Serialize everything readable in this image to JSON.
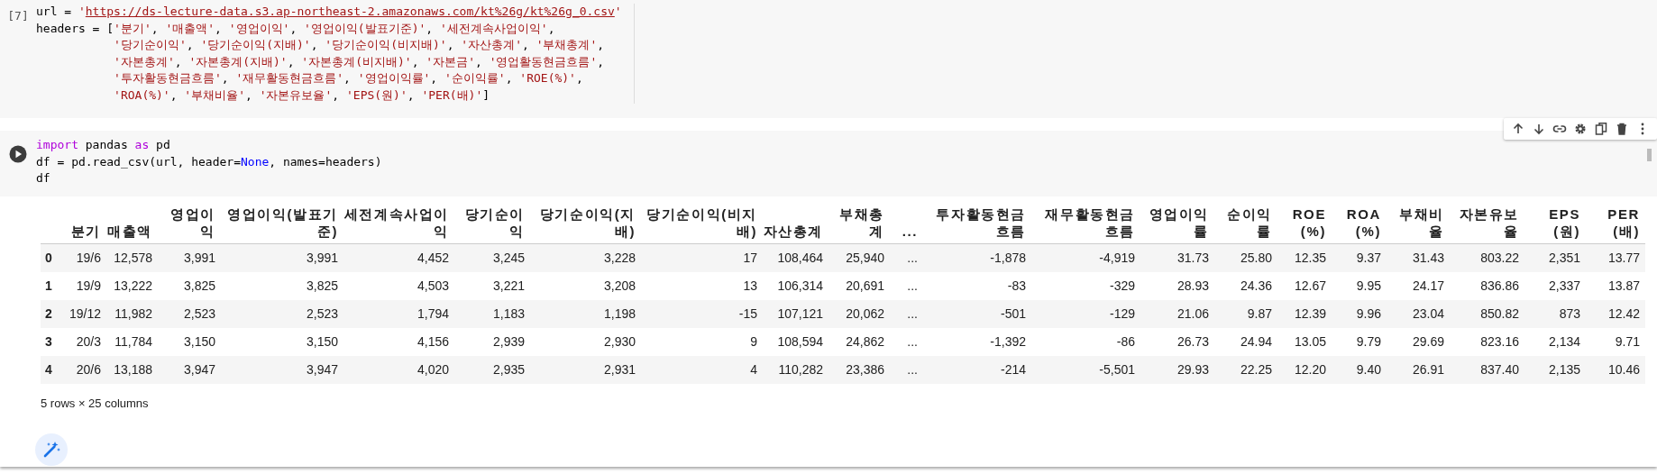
{
  "cells": [
    {
      "focused": false,
      "prompt": "[7]",
      "lines": [
        [
          {
            "kind": "plain",
            "text": "url = "
          },
          {
            "kind": "str",
            "text": "'"
          },
          {
            "kind": "link",
            "text": "https://ds-lecture-data.s3.ap-northeast-2.amazonaws.com/kt%26g/kt%26g_0.csv"
          },
          {
            "kind": "str",
            "text": "'"
          }
        ],
        [
          {
            "kind": "plain",
            "text": "headers = ["
          },
          {
            "kind": "str",
            "text": "'분기'"
          },
          {
            "kind": "plain",
            "text": ", "
          },
          {
            "kind": "str",
            "text": "'매출액'"
          },
          {
            "kind": "plain",
            "text": ", "
          },
          {
            "kind": "str",
            "text": "'영업이익'"
          },
          {
            "kind": "plain",
            "text": ", "
          },
          {
            "kind": "str",
            "text": "'영업이익(발표기준)'"
          },
          {
            "kind": "plain",
            "text": ", "
          },
          {
            "kind": "str",
            "text": "'세전계속사업이익'"
          },
          {
            "kind": "plain",
            "text": ","
          }
        ],
        [
          {
            "kind": "indent"
          },
          {
            "kind": "str",
            "text": "'당기순이익'"
          },
          {
            "kind": "plain",
            "text": ", "
          },
          {
            "kind": "str",
            "text": "'당기순이익(지배)'"
          },
          {
            "kind": "plain",
            "text": ", "
          },
          {
            "kind": "str",
            "text": "'당기순이익(비지배)'"
          },
          {
            "kind": "plain",
            "text": ", "
          },
          {
            "kind": "str",
            "text": "'자산총계'"
          },
          {
            "kind": "plain",
            "text": ", "
          },
          {
            "kind": "str",
            "text": "'부채총계'"
          },
          {
            "kind": "plain",
            "text": ","
          }
        ],
        [
          {
            "kind": "indent"
          },
          {
            "kind": "str",
            "text": "'자본총계'"
          },
          {
            "kind": "plain",
            "text": ", "
          },
          {
            "kind": "str",
            "text": "'자본총계(지배)'"
          },
          {
            "kind": "plain",
            "text": ", "
          },
          {
            "kind": "str",
            "text": "'자본총계(비지배)'"
          },
          {
            "kind": "plain",
            "text": ", "
          },
          {
            "kind": "str",
            "text": "'자본금'"
          },
          {
            "kind": "plain",
            "text": ", "
          },
          {
            "kind": "str",
            "text": "'영업활동현금흐름'"
          },
          {
            "kind": "plain",
            "text": ","
          }
        ],
        [
          {
            "kind": "indent"
          },
          {
            "kind": "str",
            "text": "'투자활동현금흐름'"
          },
          {
            "kind": "plain",
            "text": ", "
          },
          {
            "kind": "str",
            "text": "'재무활동현금흐름'"
          },
          {
            "kind": "plain",
            "text": ", "
          },
          {
            "kind": "str",
            "text": "'영업이익률'"
          },
          {
            "kind": "plain",
            "text": ", "
          },
          {
            "kind": "str",
            "text": "'순이익률'"
          },
          {
            "kind": "plain",
            "text": ", "
          },
          {
            "kind": "str",
            "text": "'ROE(%)'"
          },
          {
            "kind": "plain",
            "text": ","
          }
        ],
        [
          {
            "kind": "indent"
          },
          {
            "kind": "str",
            "text": "'ROA(%)'"
          },
          {
            "kind": "plain",
            "text": ", "
          },
          {
            "kind": "str",
            "text": "'부채비율'"
          },
          {
            "kind": "plain",
            "text": ", "
          },
          {
            "kind": "str",
            "text": "'자본유보율'"
          },
          {
            "kind": "plain",
            "text": ", "
          },
          {
            "kind": "str",
            "text": "'EPS(원)'"
          },
          {
            "kind": "plain",
            "text": ", "
          },
          {
            "kind": "str",
            "text": "'PER(배)'"
          },
          {
            "kind": "plain",
            "text": "]"
          }
        ]
      ]
    },
    {
      "focused": true,
      "lines": [
        [
          {
            "kind": "keyword",
            "text": "import"
          },
          {
            "kind": "plain",
            "text": " pandas "
          },
          {
            "kind": "keyword",
            "text": "as"
          },
          {
            "kind": "plain",
            "text": " pd"
          }
        ],
        [
          {
            "kind": "plain",
            "text": "df = pd.read_csv(url, header="
          },
          {
            "kind": "const",
            "text": "None"
          },
          {
            "kind": "plain",
            "text": ", names=headers)"
          }
        ],
        [
          {
            "kind": "plain",
            "text": "df"
          }
        ]
      ]
    }
  ],
  "output": {
    "table": {
      "columns": [
        "분기",
        "매출액",
        "영업이익",
        "영업이익(발표기준)",
        "세전계속사업이익",
        "당기순이익",
        "당기순이익(지배)",
        "당기순이익(비지배)",
        "자산총계",
        "부채총계",
        "...",
        "투자활동현금흐름",
        "재무활동현금흐름",
        "영업이익률",
        "순이익률",
        "ROE(%)",
        "ROA(%)",
        "부채비율",
        "자본유보율",
        "EPS(원)",
        "PER(배)"
      ],
      "rows": [
        {
          "index": "0",
          "cells": [
            "19/6",
            "12,578",
            "3,991",
            "3,991",
            "4,452",
            "3,245",
            "3,228",
            "17",
            "108,464",
            "25,940",
            "...",
            "-1,878",
            "-4,919",
            "31.73",
            "25.80",
            "12.35",
            "9.37",
            "31.43",
            "803.22",
            "2,351",
            "13.77"
          ]
        },
        {
          "index": "1",
          "cells": [
            "19/9",
            "13,222",
            "3,825",
            "3,825",
            "4,503",
            "3,221",
            "3,208",
            "13",
            "106,314",
            "20,691",
            "...",
            "-83",
            "-329",
            "28.93",
            "24.36",
            "12.67",
            "9.95",
            "24.17",
            "836.86",
            "2,337",
            "13.87"
          ]
        },
        {
          "index": "2",
          "cells": [
            "19/12",
            "11,982",
            "2,523",
            "2,523",
            "1,794",
            "1,183",
            "1,198",
            "-15",
            "107,121",
            "20,062",
            "...",
            "-501",
            "-129",
            "21.06",
            "9.87",
            "12.39",
            "9.96",
            "23.04",
            "850.82",
            "873",
            "12.42"
          ]
        },
        {
          "index": "3",
          "cells": [
            "20/3",
            "11,784",
            "3,150",
            "3,150",
            "4,156",
            "2,939",
            "2,930",
            "9",
            "108,594",
            "24,862",
            "...",
            "-1,392",
            "-86",
            "26.73",
            "24.94",
            "13.05",
            "9.79",
            "29.69",
            "823.16",
            "2,134",
            "9.71"
          ]
        },
        {
          "index": "4",
          "cells": [
            "20/6",
            "13,188",
            "3,947",
            "3,947",
            "4,020",
            "2,935",
            "2,931",
            "4",
            "110,282",
            "23,386",
            "...",
            "-214",
            "-5,501",
            "29.93",
            "22.25",
            "12.20",
            "9.40",
            "26.91",
            "837.40",
            "2,135",
            "10.46"
          ]
        }
      ]
    },
    "shape": "5 rows × 25 columns"
  }
}
